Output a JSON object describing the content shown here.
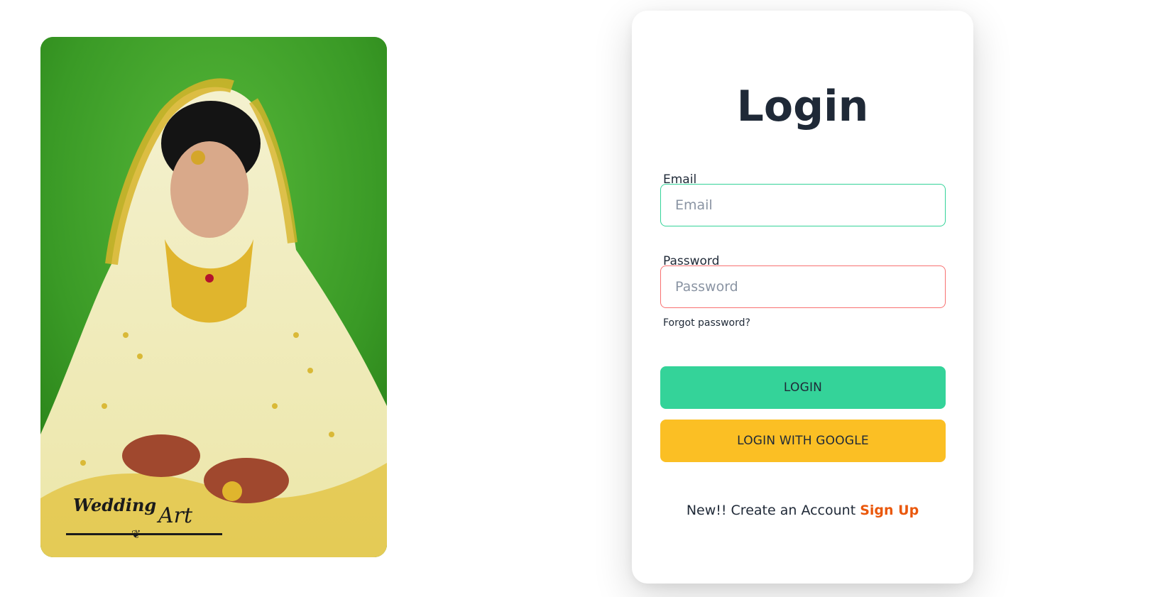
{
  "login": {
    "title": "Login",
    "email_label": "Email",
    "email_placeholder": "Email",
    "password_label": "Password",
    "password_placeholder": "Password",
    "forgot_password": "Forgot password?",
    "login_button": "LOGIN",
    "google_button": "LOGIN WITH GOOGLE",
    "signup_prompt": "New!! Create an Account",
    "signup_link": "Sign Up"
  },
  "photo": {
    "watermark_line1": "Wedding",
    "watermark_line2": "Art"
  },
  "colors": {
    "login_button": "#34d399",
    "google_button": "#fbbf24",
    "signup_link": "#ea580c",
    "email_border": "#34d399",
    "password_border": "#f87171",
    "title": "#1f2937"
  },
  "icons": {
    "photo": "bride-photo"
  }
}
